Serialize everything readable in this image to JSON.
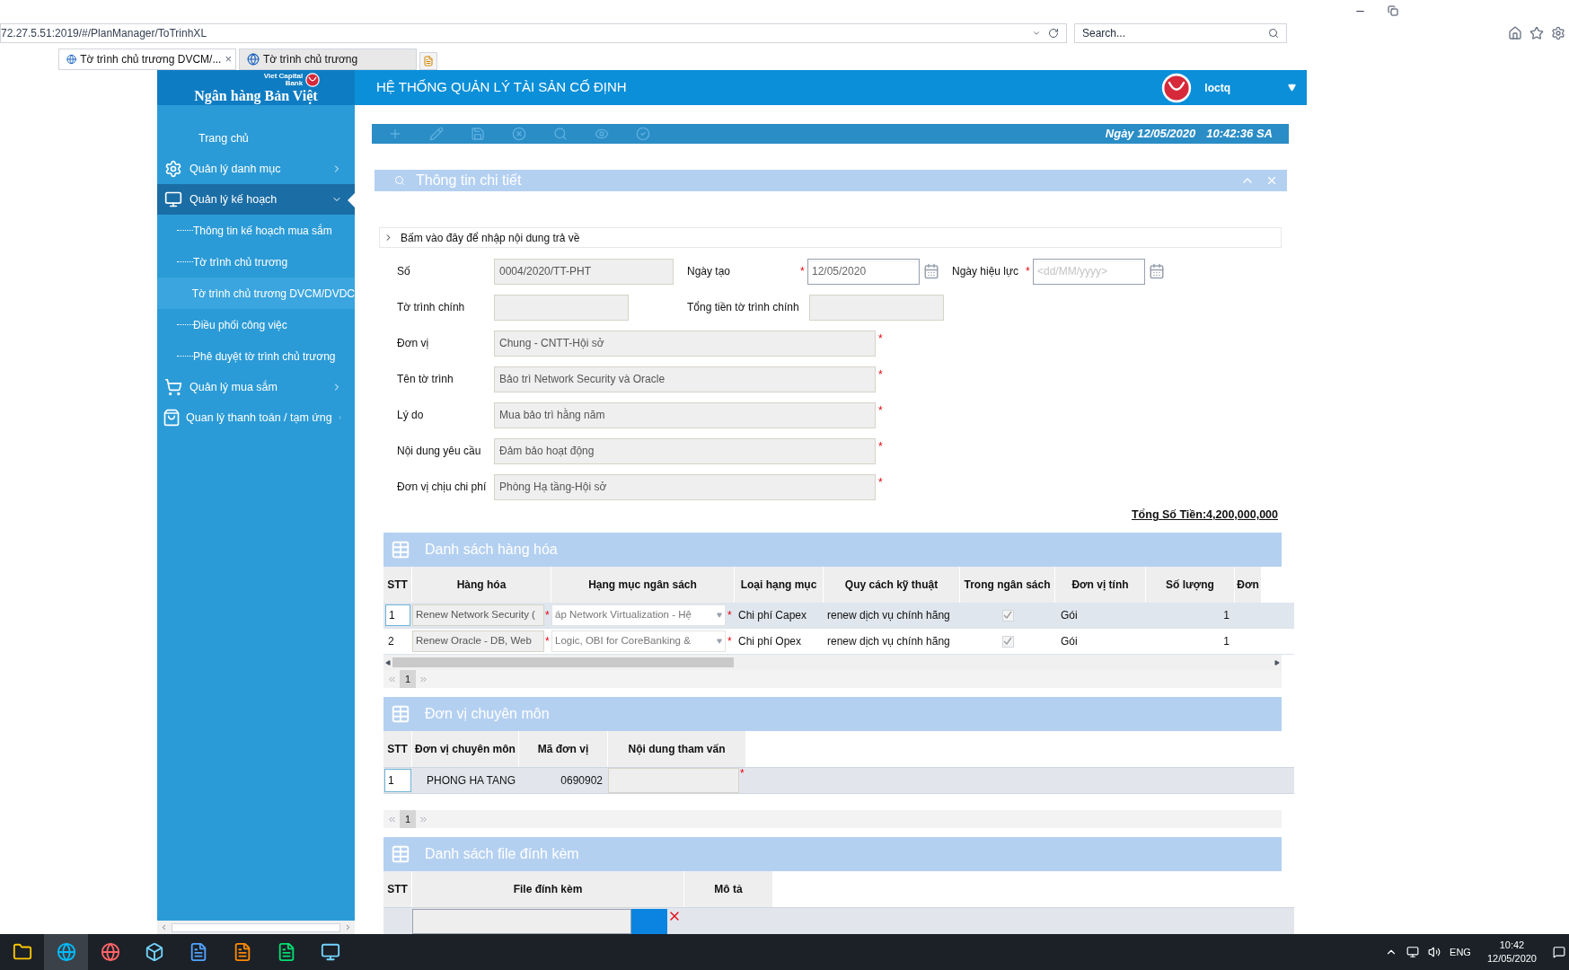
{
  "browser": {
    "address": "72.27.5.51:2019/#/PlanManager/ToTrinhXL",
    "search_placeholder": "Search...",
    "tabs": [
      {
        "label": "Tờ trình chủ trương DVCM/...",
        "selected": true
      },
      {
        "label": "Tờ trình chủ trương",
        "selected": false
      }
    ],
    "tab_close": "×"
  },
  "app": {
    "logo_small": "Viet Capital",
    "logo_small_2": "Bank",
    "logo": "Ngân hàng Bản Việt",
    "title": "HỆ THỐNG QUẢN LÝ TÀI SẢN CỐ ĐỊNH",
    "user": "loctq"
  },
  "sidebar": {
    "items": [
      {
        "label": "Trang chủ",
        "selected": false
      },
      {
        "label": "Quản lý danh mục",
        "expanded": false,
        "selected": false
      },
      {
        "label": "Quản lý kế hoạch",
        "expanded": true,
        "selected": true,
        "children": [
          {
            "label": "Thông tin kế hoạch mua sắm",
            "selected": false
          },
          {
            "label": "Tờ trình chủ trương",
            "selected": false
          },
          {
            "label": "Tờ trình chủ trương DVCM/DVDC",
            "selected": true
          },
          {
            "label": "Điều phối công việc",
            "selected": false
          },
          {
            "label": "Phê duyệt tờ trình chủ trương",
            "selected": false
          }
        ]
      },
      {
        "label": "Quản lý mua sắm",
        "expanded": false,
        "selected": false
      },
      {
        "label": "Quan lý thanh toán / tạm ứng",
        "expanded": false,
        "selected": false
      }
    ]
  },
  "toolbar": {
    "date": "Ngày 12/05/2020",
    "time": "10:42:36 SA"
  },
  "panel": {
    "title": "Thông tin chi tiết",
    "return_note": "Bấm vào đây để nhập nội dung trả về"
  },
  "form": {
    "row_1": [
      {
        "label": "Số",
        "kind": "text",
        "value": "0004/2020/TT-PHT",
        "required": false
      },
      {
        "label": "Ngày tạo",
        "kind": "date",
        "value": "12/05/2020",
        "required": true
      },
      {
        "label": "Ngày hiệu lực",
        "kind": "date",
        "placeholder": "<dd/MM/yyyy>",
        "required": true
      }
    ],
    "row_2": [
      {
        "label": "Tờ trình chính",
        "kind": "text",
        "required": false
      },
      {
        "label": "Tổng tiền tờ trình chính",
        "kind": "text",
        "required": false
      }
    ],
    "wide_fields": [
      {
        "label": "Đơn vị",
        "value": "Chung - CNTT-Hội sở",
        "required": true
      },
      {
        "label": "Tên tờ trình",
        "value": "Bảo trì Network Security và Oracle",
        "required": true
      },
      {
        "label": "Lý do",
        "value": "Mua bảo trì hằng năm",
        "required": true
      },
      {
        "label": "Nội dung yêu cầu",
        "value": "Đảm bảo hoạt động",
        "required": true
      },
      {
        "label": "Đơn vị chịu chi phí",
        "value": "Phòng Hạ tầng-Hội sở",
        "required": true
      }
    ],
    "total": "Tổng Số Tiền:4,200,000,000"
  },
  "goods": {
    "title": "Danh sách hàng hóa",
    "columns": [
      "STT",
      "Hàng hóa",
      "Hạng mục ngân sách",
      "Loại hạng mục",
      "Quy cách kỹ thuật",
      "Trong ngân sách",
      "Đơn vị tính",
      "Số lượng",
      "Đơn"
    ],
    "rows": [
      {
        "stt": "1",
        "goods": "Renew Network Security (",
        "budget_item": "áp Network Virtualization - Hệ",
        "category": "Chi phí Capex",
        "spec": "renew dịch vụ chính hãng",
        "in_budget": true,
        "unit": "Gói",
        "quantity": "1",
        "selected": true
      },
      {
        "stt": "2",
        "goods": "Renew Oracle - DB, Web",
        "budget_item": "Logic, OBI for CoreBanking &",
        "category": "Chi phí Opex",
        "spec": "renew dịch vụ chính hãng",
        "in_budget": true,
        "unit": "Gói",
        "quantity": "1",
        "selected": false
      }
    ],
    "page": "1"
  },
  "experts": {
    "title": "Đơn vị chuyên môn",
    "columns": [
      "STT",
      "Đơn vị chuyên môn",
      "Mã đơn vị",
      "Nội dung tham vấn"
    ],
    "rows": [
      {
        "stt": "1",
        "unit": "PHONG HA TANG",
        "code": "0690902",
        "required": true
      }
    ],
    "page": "1"
  },
  "files": {
    "title": "Danh sách file đính kèm",
    "columns": [
      "STT",
      "File đính kèm",
      "Mô tả"
    ]
  },
  "required_mark": "*",
  "taskbar": {
    "language": "ENG",
    "time": "10:42",
    "date": "12/05/2020"
  }
}
